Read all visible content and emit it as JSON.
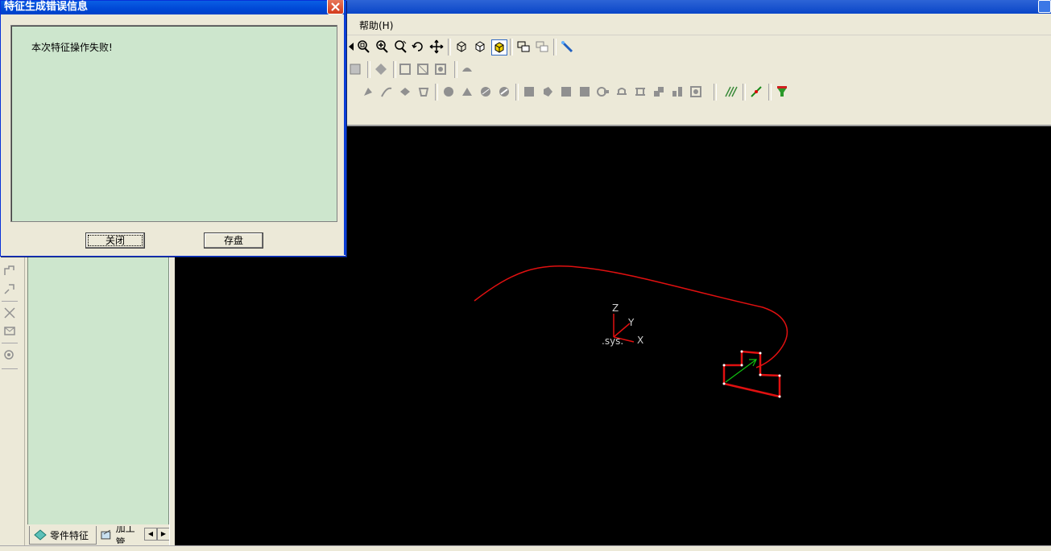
{
  "dialog": {
    "title": "特征生成错误信息",
    "message": "本次特征操作失败!",
    "close_button": "关闭",
    "save_button": "存盘"
  },
  "menubar": {
    "help": "帮助(H)"
  },
  "feature_panel": {
    "tabs": [
      {
        "label": "零件特征",
        "icon": "part-feature-icon"
      },
      {
        "label": "加工管",
        "icon": "machining-icon"
      }
    ]
  },
  "viewport": {
    "axis_labels": {
      "z": "Z",
      "y": "Y",
      "x": "X",
      "origin": ".sys."
    },
    "colors": {
      "background": "#000000",
      "curve": "#ff0000",
      "axis": "#ff0000",
      "normal": "#00c000",
      "point": "#ffffff"
    }
  }
}
